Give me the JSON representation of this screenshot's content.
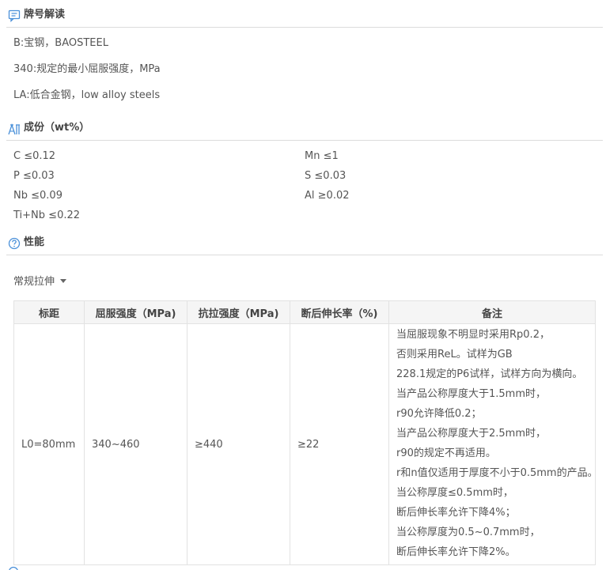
{
  "brand_section": {
    "title": "牌号解读",
    "icon": "comment-icon",
    "lines": [
      "B:宝钢，BAOSTEEL",
      "340:规定的最小屈服强度，MPa",
      "LA:低合金钢，low alloy steels"
    ]
  },
  "composition_section": {
    "title": "成份（wt%）",
    "icon": "flask-icon",
    "items": [
      {
        "el": "C",
        "val": "≤0.12"
      },
      {
        "el": "Mn",
        "val": "≤1"
      },
      {
        "el": "P",
        "val": "≤0.03"
      },
      {
        "el": "S",
        "val": "≤0.03"
      },
      {
        "el": "Nb",
        "val": "≤0.09"
      },
      {
        "el": "Al",
        "val": "≥0.02"
      },
      {
        "el": "Ti+Nb",
        "val": "≤0.22"
      }
    ]
  },
  "performance_section": {
    "title": "性能",
    "icon": "question-circle-icon",
    "dropdown": {
      "selected": "常规拉伸"
    },
    "table": {
      "headers": [
        "标距",
        "屈服强度（MPa)",
        "抗拉强度（MPa)",
        "断后伸长率（%)",
        "备注"
      ],
      "rows": [
        {
          "gauge": "L0=80mm",
          "yield": "340~460",
          "tensile": "≥440",
          "elongation": "≥22",
          "notes": [
            "当屈服现象不明显时采用Rp0.2，",
            "否则采用ReL。试样为GB",
            "228.1规定的P6试样，试样方向为横向。",
            "当产品公称厚度大于1.5mm时，",
            "r90允许降低0.2；",
            "当产品公称厚度大于2.5mm时，",
            "r90的规定不再适用。",
            "r和n值仅适用于厚度不小于0.5mm的产品。",
            "当公称厚度≤0.5mm时，",
            "断后伸长率允许下降4%；",
            "当公称厚度为0.5~0.7mm时，",
            "断后伸长率允许下降2%。"
          ]
        }
      ]
    }
  },
  "colors": {
    "accent": "#4a90d9",
    "border": "#dcdcdc",
    "text": "#555555",
    "header_bg": "#f5f5f5"
  }
}
